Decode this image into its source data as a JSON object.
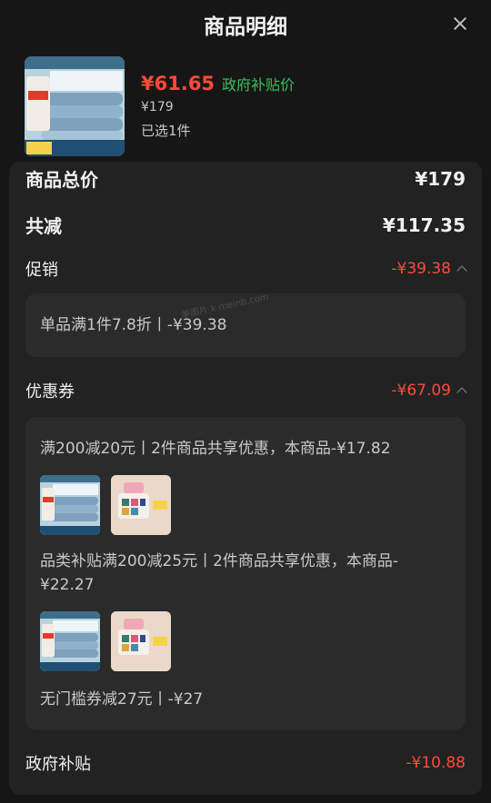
{
  "header": {
    "title": "商品明细"
  },
  "product": {
    "final_price": "¥61.65",
    "subsidy_tag": "政府补贴价",
    "original_price": "¥179",
    "selected": "已选1件"
  },
  "summary": {
    "total_label": "商品总价",
    "total_value": "¥179",
    "discount_label": "共减",
    "discount_value": "¥117.35"
  },
  "promotion": {
    "label": "促销",
    "value": "-¥39.38",
    "detail": "单品满1件7.8折丨-¥39.38"
  },
  "coupon": {
    "label": "优惠券",
    "value": "-¥67.09",
    "items": [
      {
        "text": "满200减20元丨2件商品共享优惠，本商品-¥17.82"
      },
      {
        "text": "品类补贴满200减25元丨2件商品共享优惠，本商品-¥22.27"
      },
      {
        "text": "无门槛券减27元丨-¥27"
      }
    ]
  },
  "gov_subsidy": {
    "label": "政府补贴",
    "value": "-¥10.88"
  },
  "watermark": "单图片 k.meinb.com",
  "colors": {
    "accent_red": "#ff4a3b",
    "accent_green": "#37c25b",
    "background": "#161616",
    "card": "#222222"
  },
  "icons": [
    "close-icon",
    "chevron-up-icon"
  ]
}
